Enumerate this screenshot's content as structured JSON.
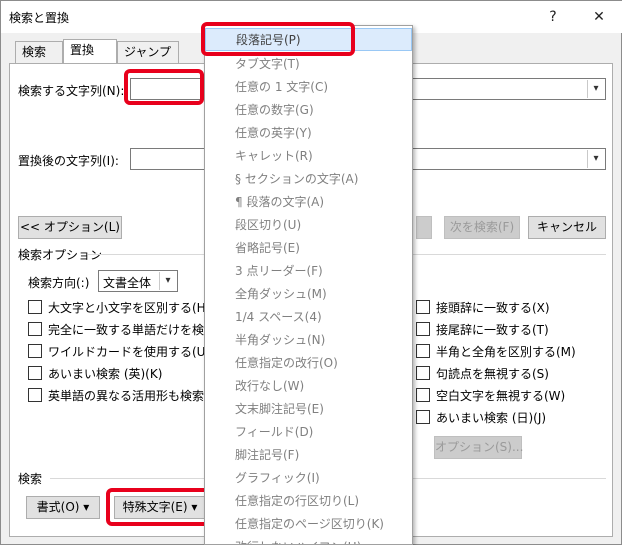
{
  "window": {
    "title": "検索と置換",
    "help": "?",
    "close": "✕"
  },
  "tabs": [
    {
      "label": "検索"
    },
    {
      "label": "置換"
    },
    {
      "label": "ジャンプ"
    }
  ],
  "find_label": "検索する文字列(N):",
  "replace_label": "置換後の文字列(I):",
  "buttons": {
    "options_toggle": "<< オプション(L)",
    "find_next": "次を検索(F)",
    "cancel": "キャンセル",
    "format": "書式(O) ▾",
    "special": "特殊文字(E) ▾",
    "extra_options": "オプション(S)..."
  },
  "search_options": {
    "title": "検索オプション",
    "direction_label": "検索方向(:)",
    "direction_value": "文書全体",
    "left": [
      "大文字と小文字を区別する(H)",
      "完全に一致する単語だけを検索す",
      "ワイルドカードを使用する(U)",
      "あいまい検索 (英)(K)",
      "英単語の異なる活用形も検索する"
    ],
    "right": [
      "接頭辞に一致する(X)",
      "接尾辞に一致する(T)",
      "半角と全角を区別する(M)",
      "句読点を無視する(S)",
      "空白文字を無視する(W)",
      "あいまい検索 (日)(J)"
    ]
  },
  "search_section": "検索",
  "menu_items": [
    "段落記号(P)",
    "タブ文字(T)",
    "任意の 1 文字(C)",
    "任意の数字(G)",
    "任意の英字(Y)",
    "キャレット(R)",
    "§ セクションの文字(A)",
    "¶ 段落の文字(A)",
    "段区切り(U)",
    "省略記号(E)",
    "3 点リーダー(F)",
    "全角ダッシュ(M)",
    "1/4 スペース(4)",
    "半角ダッシュ(N)",
    "任意指定の改行(O)",
    "改行なし(W)",
    "文末脚注記号(E)",
    "フィールド(D)",
    "脚注記号(F)",
    "グラフィック(I)",
    "任意指定の行区切り(L)",
    "任意指定のページ区切り(K)",
    "改行しないハイフン(H)"
  ]
}
